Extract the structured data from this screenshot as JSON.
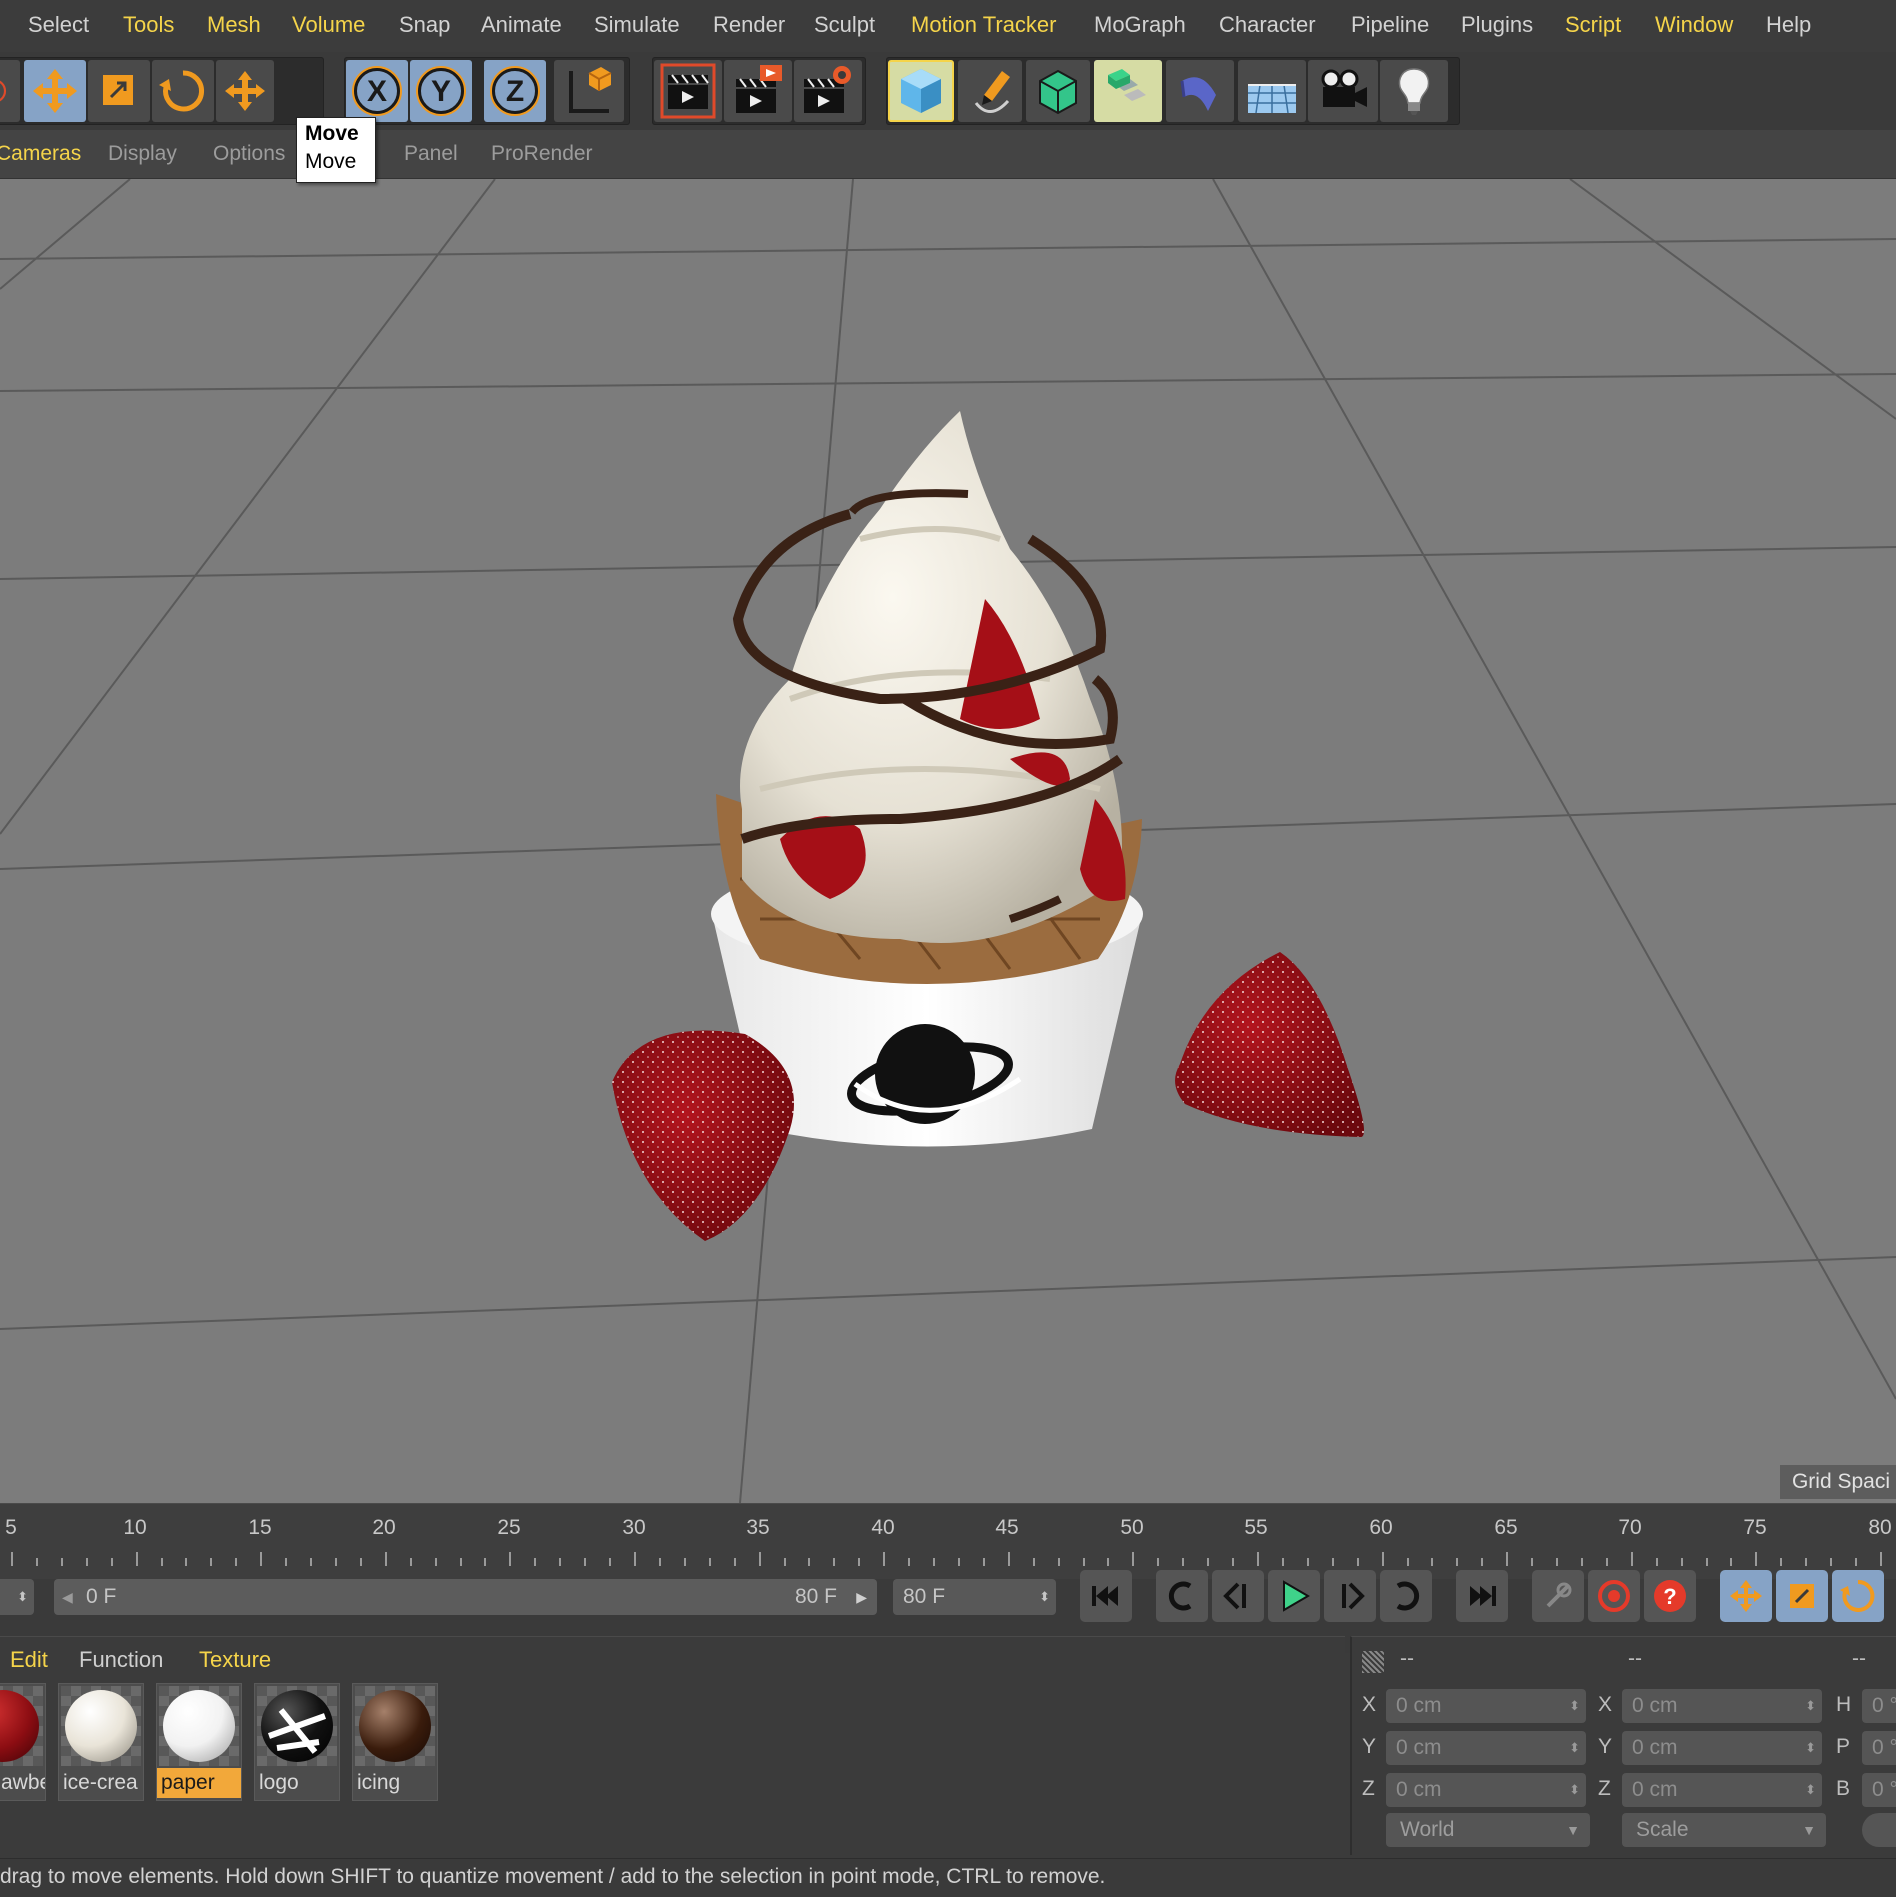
{
  "menubar": {
    "items": [
      {
        "label": "Select",
        "highlight": false
      },
      {
        "label": "Tools",
        "highlight": true
      },
      {
        "label": "Mesh",
        "highlight": true
      },
      {
        "label": "Volume",
        "highlight": true
      },
      {
        "label": "Snap",
        "highlight": false
      },
      {
        "label": "Animate",
        "highlight": false
      },
      {
        "label": "Simulate",
        "highlight": false
      },
      {
        "label": "Render",
        "highlight": false
      },
      {
        "label": "Sculpt",
        "highlight": false
      },
      {
        "label": "Motion Tracker",
        "highlight": true
      },
      {
        "label": "MoGraph",
        "highlight": false
      },
      {
        "label": "Character",
        "highlight": false
      },
      {
        "label": "Pipeline",
        "highlight": false
      },
      {
        "label": "Plugins",
        "highlight": false
      },
      {
        "label": "Script",
        "highlight": true
      },
      {
        "label": "Window",
        "highlight": true
      },
      {
        "label": "Help",
        "highlight": false
      }
    ]
  },
  "toolbar": {
    "icons": [
      "live-selection-icon",
      "move-icon",
      "scale-icon",
      "rotate-icon",
      "move-icon",
      "x-axis-icon",
      "y-axis-icon",
      "z-axis-icon",
      "coordinate-system-icon",
      "render-view-icon",
      "render-picture-viewer-icon",
      "render-settings-icon",
      "cube-icon",
      "pen-spline-icon",
      "subdivision-surface-icon",
      "array-icon",
      "bend-deformer-icon",
      "floor-icon",
      "camera-icon",
      "light-icon"
    ]
  },
  "tooltip": {
    "title": "Move",
    "text": "Move"
  },
  "viewport": {
    "menu": [
      {
        "label": "Cameras",
        "highlight": true
      },
      {
        "label": "Display",
        "highlight": false
      },
      {
        "label": "Options",
        "highlight": false
      },
      {
        "label": "Panel",
        "highlight": false
      },
      {
        "label": "ProRender",
        "highlight": false
      }
    ],
    "grid_spacing_label": "Grid Spaci"
  },
  "timeline": {
    "ticks": [
      "5",
      "10",
      "15",
      "20",
      "25",
      "30",
      "35",
      "40",
      "45",
      "50",
      "55",
      "60",
      "65",
      "70",
      "75",
      "80"
    ]
  },
  "playback": {
    "current_frame": "0 F",
    "range_end": "80 F",
    "end_frame": "80 F"
  },
  "material_manager": {
    "menu": [
      {
        "label": "Edit",
        "highlight": true
      },
      {
        "label": "Function",
        "highlight": false
      },
      {
        "label": "Texture",
        "highlight": true
      }
    ],
    "materials": [
      {
        "label": "awbe",
        "color": "#8c0d12",
        "selected": false
      },
      {
        "label": "ice-crea",
        "color": "#e9e4d8",
        "selected": false
      },
      {
        "label": "paper",
        "color": "#f2f2f2",
        "selected": true
      },
      {
        "label": "logo",
        "color": "#111111",
        "selected": false
      },
      {
        "label": "icing",
        "color": "#3a1c0c",
        "selected": false
      }
    ]
  },
  "coordinates": {
    "header": [
      "--",
      "--",
      "--"
    ],
    "rows": [
      {
        "axis": "X",
        "pos": "0 cm",
        "size_axis": "X",
        "size": "0 cm",
        "rot_axis": "H",
        "rot": "0 °"
      },
      {
        "axis": "Y",
        "pos": "0 cm",
        "size_axis": "Y",
        "size": "0 cm",
        "rot_axis": "P",
        "rot": "0 °"
      },
      {
        "axis": "Z",
        "pos": "0 cm",
        "size_axis": "Z",
        "size": "0 cm",
        "rot_axis": "B",
        "rot": "0 °"
      }
    ],
    "mode_dropdown": "World",
    "size_dropdown": "Scale"
  },
  "statusbar": {
    "text": "drag to move elements. Hold down SHIFT to quantize movement / add to the selection in point mode, CTRL to remove."
  },
  "colors": {
    "accent_yellow": "#f5d44a",
    "active_blue": "#86a3c6",
    "selected_orange": "#f2a83a"
  }
}
